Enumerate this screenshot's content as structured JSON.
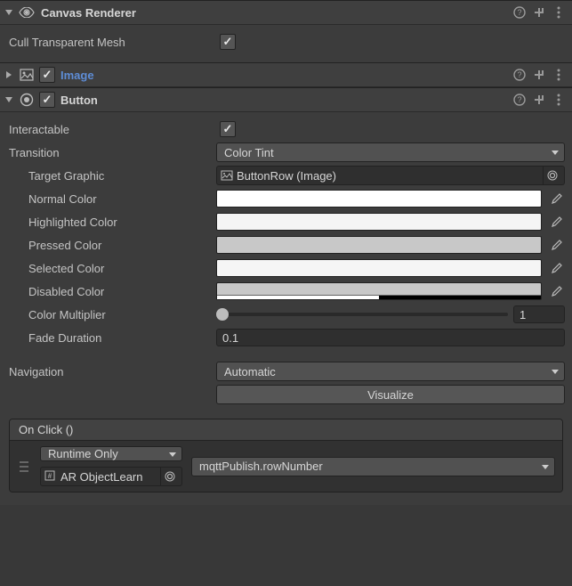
{
  "components": {
    "canvasRenderer": {
      "title": "Canvas Renderer",
      "cullTransparentMesh": {
        "label": "Cull Transparent Mesh",
        "checked": true
      }
    },
    "image": {
      "title": "Image",
      "enabled": true
    },
    "button": {
      "title": "Button",
      "enabled": true,
      "interactable": {
        "label": "Interactable",
        "checked": true
      },
      "transition": {
        "label": "Transition",
        "value": "Color Tint"
      },
      "targetGraphic": {
        "label": "Target Graphic",
        "value": "ButtonRow (Image)"
      },
      "normalColor": {
        "label": "Normal Color",
        "hex": "#ffffff"
      },
      "highlightedColor": {
        "label": "Highlighted Color",
        "hex": "#f5f5f5"
      },
      "pressedColor": {
        "label": "Pressed Color",
        "hex": "#c8c8c8"
      },
      "selectedColor": {
        "label": "Selected Color",
        "hex": "#f5f5f5"
      },
      "disabledColor": {
        "label": "Disabled Color",
        "hex": "#c8c8c8",
        "alphaFrac": 0.5
      },
      "colorMultiplier": {
        "label": "Color Multiplier",
        "value": "1",
        "sliderPos": 0.0
      },
      "fadeDuration": {
        "label": "Fade Duration",
        "value": "0.1"
      },
      "navigation": {
        "label": "Navigation",
        "value": "Automatic"
      },
      "visualize": "Visualize",
      "onClick": {
        "title": "On Click ()",
        "state": "Runtime Only",
        "method": "mqttPublish.rowNumber",
        "target": "AR ObjectLearn"
      }
    }
  }
}
